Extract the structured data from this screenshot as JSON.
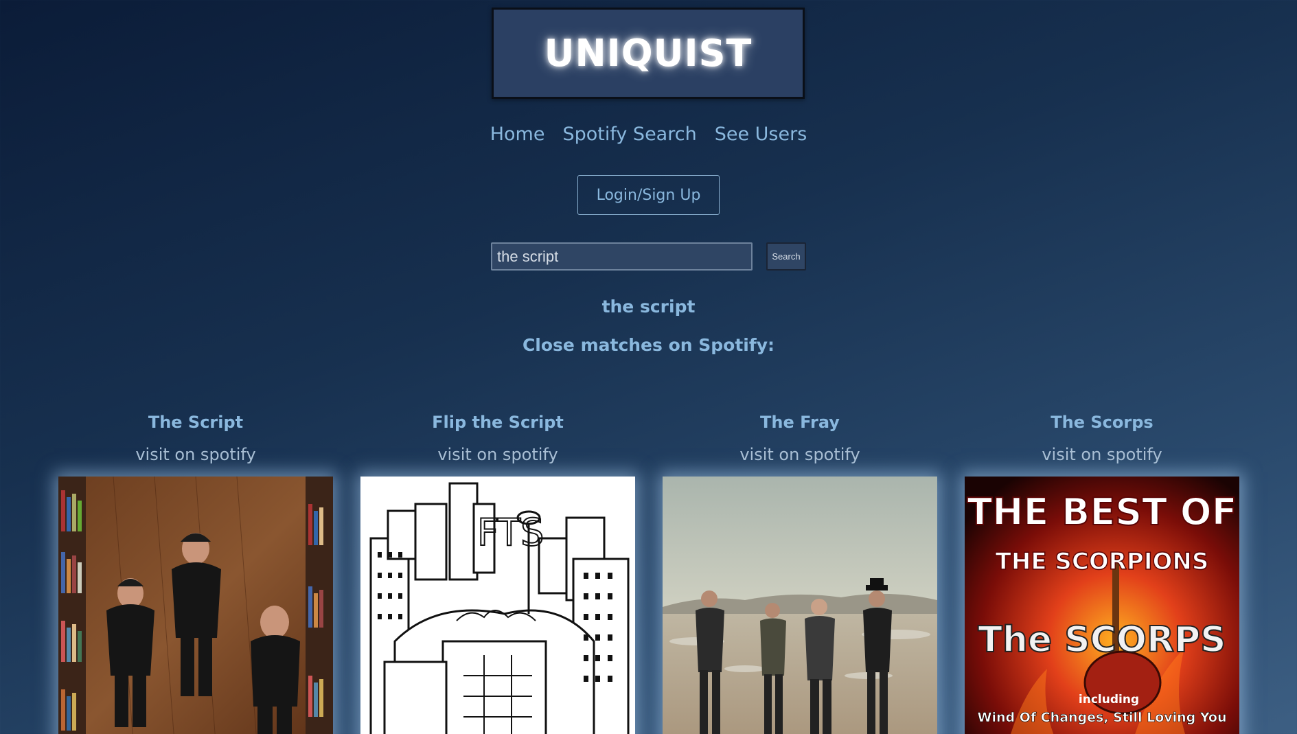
{
  "header": {
    "logo_text": "UNIQUIST"
  },
  "nav": {
    "items": [
      {
        "label": "Home"
      },
      {
        "label": "Spotify Search"
      },
      {
        "label": "See Users"
      }
    ]
  },
  "auth": {
    "login_label": "Login/Sign Up"
  },
  "search": {
    "value": "the script",
    "button_label": "Search"
  },
  "results": {
    "query_echo": "the script",
    "heading": "Close matches on Spotify:",
    "items": [
      {
        "name": "The Script",
        "link_label": "visit on spotify",
        "image_icon": "band-photo-wood-floor"
      },
      {
        "name": "Flip the Script",
        "link_label": "visit on spotify",
        "image_icon": "city-sketch-artwork",
        "art_text": "FTS"
      },
      {
        "name": "The Fray",
        "link_label": "visit on spotify",
        "image_icon": "band-photo-desert"
      },
      {
        "name": "The Scorps",
        "link_label": "visit on spotify",
        "image_icon": "album-cover-scorps",
        "art_lines": [
          "THE BEST OF",
          "THE SCORPIONS",
          "The SCORPS",
          "including",
          "Wind Of Changes, Still Loving You"
        ]
      }
    ]
  }
}
